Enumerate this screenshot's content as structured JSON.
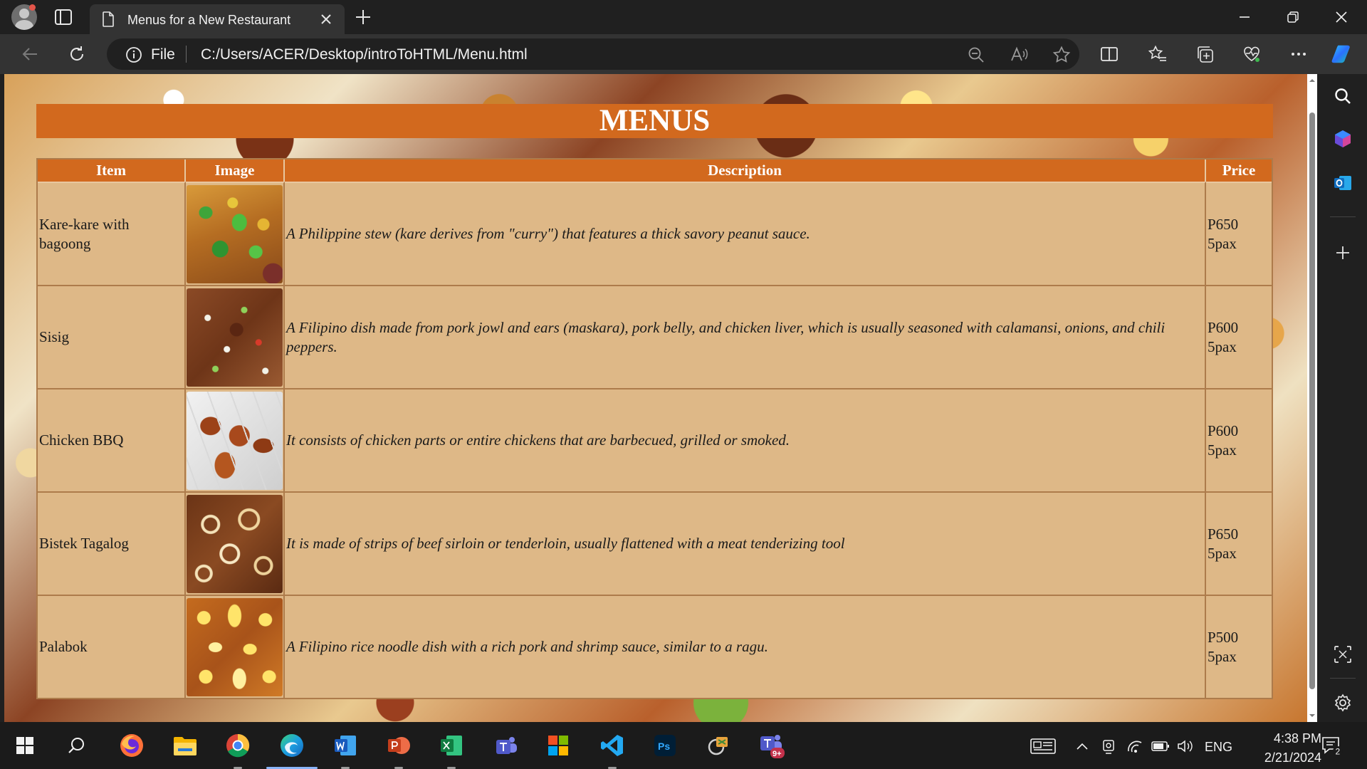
{
  "browser": {
    "tab_title": "Menus for a New Restaurant",
    "address": {
      "scheme_label": "File",
      "url": "C:/Users/ACER/Desktop/introToHTML/Menu.html"
    }
  },
  "page": {
    "heading": "MENUS",
    "table": {
      "headers": [
        "Item",
        "Image",
        "Description",
        "Price"
      ],
      "rows": [
        {
          "item": "Kare-kare with bagoong",
          "image": "kare-kare-photo",
          "description": "A Philippine stew (kare derives from \"curry\") that features a thick savory peanut sauce.",
          "price": "P650",
          "serving": "5pax"
        },
        {
          "item": "Sisig",
          "image": "sisig-photo",
          "description": "A Filipino dish made from pork jowl and ears (maskara), pork belly, and chicken liver, which is usually seasoned with calamansi, onions, and chili peppers.",
          "price": "P600",
          "serving": "5pax"
        },
        {
          "item": "Chicken BBQ",
          "image": "chicken-bbq-photo",
          "description": "It consists of chicken parts or entire chickens that are barbecued, grilled or smoked.",
          "price": "P600",
          "serving": "5pax"
        },
        {
          "item": "Bistek Tagalog",
          "image": "bistek-tagalog-photo",
          "description": "It is made of strips of beef sirloin or tenderloin, usually flattened with a meat tenderizing tool",
          "price": "P650",
          "serving": "5pax"
        },
        {
          "item": "Palabok",
          "image": "palabok-photo",
          "description": "A Filipino rice noodle dish with a rich pork and shrimp sauce, similar to a ragu.",
          "price": "P500",
          "serving": "5pax"
        }
      ]
    }
  },
  "taskbar": {
    "language": "ENG",
    "time": "4:38 PM",
    "date": "2/21/2024",
    "teams_badge": "9+",
    "notification_count": "2"
  },
  "colors": {
    "header_orange": "#d2691e",
    "table_tan": "#deb887",
    "chrome_dark": "#202020",
    "chrome_toolbar": "#333333",
    "taskbar": "#1b1b1b"
  }
}
